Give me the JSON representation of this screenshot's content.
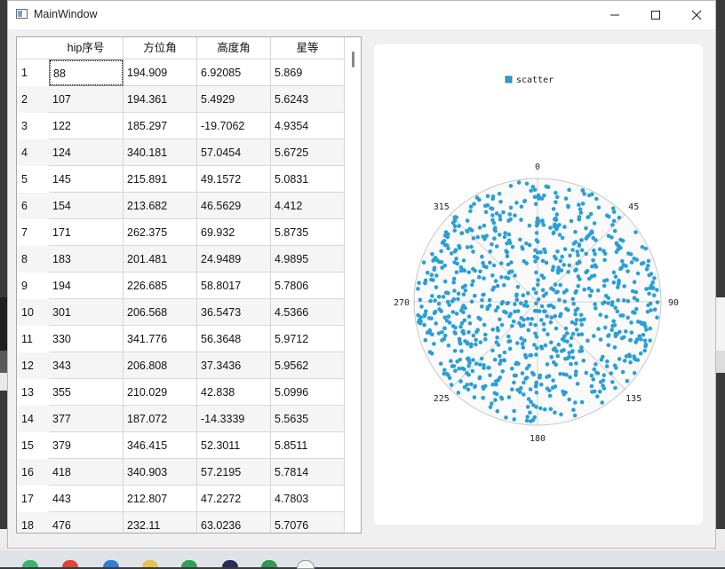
{
  "window": {
    "title": "MainWindow",
    "controls": {
      "minimize": "—",
      "maximize": "☐",
      "close": "✕"
    }
  },
  "table": {
    "columns": [
      "hip序号",
      "方位角",
      "高度角",
      "星等"
    ],
    "rows": [
      {
        "num": "1",
        "hip": "88",
        "az": "194.909",
        "alt": "6.92085",
        "mag": "5.869"
      },
      {
        "num": "2",
        "hip": "107",
        "az": "194.361",
        "alt": "5.4929",
        "mag": "5.6243"
      },
      {
        "num": "3",
        "hip": "122",
        "az": "185.297",
        "alt": "-19.7062",
        "mag": "4.9354"
      },
      {
        "num": "4",
        "hip": "124",
        "az": "340.181",
        "alt": "57.0454",
        "mag": "5.6725"
      },
      {
        "num": "5",
        "hip": "145",
        "az": "215.891",
        "alt": "49.1572",
        "mag": "5.0831"
      },
      {
        "num": "6",
        "hip": "154",
        "az": "213.682",
        "alt": "46.5629",
        "mag": "4.412"
      },
      {
        "num": "7",
        "hip": "171",
        "az": "262.375",
        "alt": "69.932",
        "mag": "5.8735"
      },
      {
        "num": "8",
        "hip": "183",
        "az": "201.481",
        "alt": "24.9489",
        "mag": "4.9895"
      },
      {
        "num": "9",
        "hip": "194",
        "az": "226.685",
        "alt": "58.8017",
        "mag": "5.7806"
      },
      {
        "num": "10",
        "hip": "301",
        "az": "206.568",
        "alt": "36.5473",
        "mag": "4.5366"
      },
      {
        "num": "11",
        "hip": "330",
        "az": "341.776",
        "alt": "56.3648",
        "mag": "5.9712"
      },
      {
        "num": "12",
        "hip": "343",
        "az": "206.808",
        "alt": "37.3436",
        "mag": "5.9562"
      },
      {
        "num": "13",
        "hip": "355",
        "az": "210.029",
        "alt": "42.838",
        "mag": "5.0996"
      },
      {
        "num": "14",
        "hip": "377",
        "az": "187.072",
        "alt": "-14.3339",
        "mag": "5.5635"
      },
      {
        "num": "15",
        "hip": "379",
        "az": "346.415",
        "alt": "52.3011",
        "mag": "5.8511"
      },
      {
        "num": "16",
        "hip": "418",
        "az": "340.903",
        "alt": "57.2195",
        "mag": "5.7814"
      },
      {
        "num": "17",
        "hip": "443",
        "az": "212.807",
        "alt": "47.2272",
        "mag": "4.7803"
      },
      {
        "num": "18",
        "hip": "476",
        "az": "232.11",
        "alt": "63.0236",
        "mag": "5.7076"
      }
    ]
  },
  "chart_data": {
    "type": "scatter",
    "projection": "polar",
    "legend": [
      "scatter"
    ],
    "legend_position": "top",
    "angular_ticks": [
      "0",
      "45",
      "90",
      "135",
      "180",
      "225",
      "270",
      "315"
    ],
    "series_color": "#2a9fd6",
    "note_points": "dense field of roughly 900 points filling the polar disc; representative points listed from the table",
    "series": [
      {
        "name": "scatter",
        "theta_deg": [
          194.909,
          194.361,
          340.181,
          215.891,
          213.682,
          262.375,
          201.481,
          226.685,
          206.568,
          341.776,
          206.808,
          210.029,
          346.415,
          340.903,
          212.807,
          232.11
        ],
        "r": [
          6.92085,
          5.4929,
          57.0454,
          49.1572,
          46.5629,
          69.932,
          24.9489,
          58.8017,
          36.5473,
          56.3648,
          37.3436,
          42.838,
          52.3011,
          57.2195,
          47.2272,
          63.0236
        ]
      }
    ]
  },
  "colors": {
    "accent": "#2a9fd6",
    "window_bg": "#f0f0f0",
    "grid": "#cccccc"
  }
}
